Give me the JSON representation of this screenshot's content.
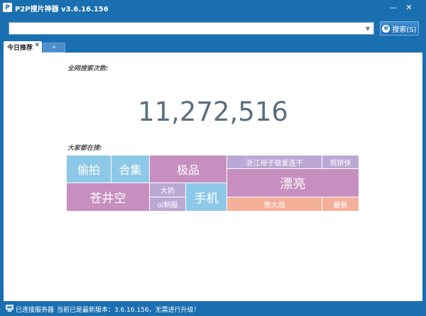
{
  "window": {
    "title": "P2P搜片神器 v3.6.16.156",
    "app_icon": "P",
    "minimize": "—",
    "close": "✕"
  },
  "toolbar": {
    "search_value": "",
    "search_placeholder": "",
    "search_button_label": "搜索(S)",
    "search_button_icon": "e"
  },
  "tabs": [
    {
      "label": "今日推荐",
      "close": "✕"
    },
    {
      "label": "+"
    }
  ],
  "main": {
    "total_label": "全网搜索次数:",
    "total_count": "11,272,516",
    "popular_label": "大家都在搜:",
    "tiles": [
      {
        "label": "偷拍",
        "color": "#8ec8e8"
      },
      {
        "label": "合集",
        "color": "#8ec8e8"
      },
      {
        "label": "极品",
        "color": "#c68fbf"
      },
      {
        "label": "浙江母子做爱连干",
        "color": "#bba8d4"
      },
      {
        "label": "煎饼侠",
        "color": "#bba8d4"
      },
      {
        "label": "漂亮",
        "color": "#c68fbf"
      },
      {
        "label": "苍井空",
        "color": "#c68fbf"
      },
      {
        "label": "大奶",
        "color": "#bba8d4"
      },
      {
        "label": "手机",
        "color": "#8ec8e8"
      },
      {
        "label": "ol制服",
        "color": "#bba8d4"
      },
      {
        "label": "熟大战",
        "color": "#f5b09a"
      },
      {
        "label": "最新",
        "color": "#f5b09a"
      }
    ]
  },
  "status": {
    "connected": "已连接服务器",
    "version_text": "当前已是最新版本：3.6.16.156，无需进行升级！"
  },
  "colors": {
    "chrome": "#1a6fb0",
    "tile_blue": "#8ec8e8",
    "tile_purple": "#c68fbf",
    "tile_lavender": "#bba8d4",
    "tile_salmon": "#f5b09a"
  }
}
